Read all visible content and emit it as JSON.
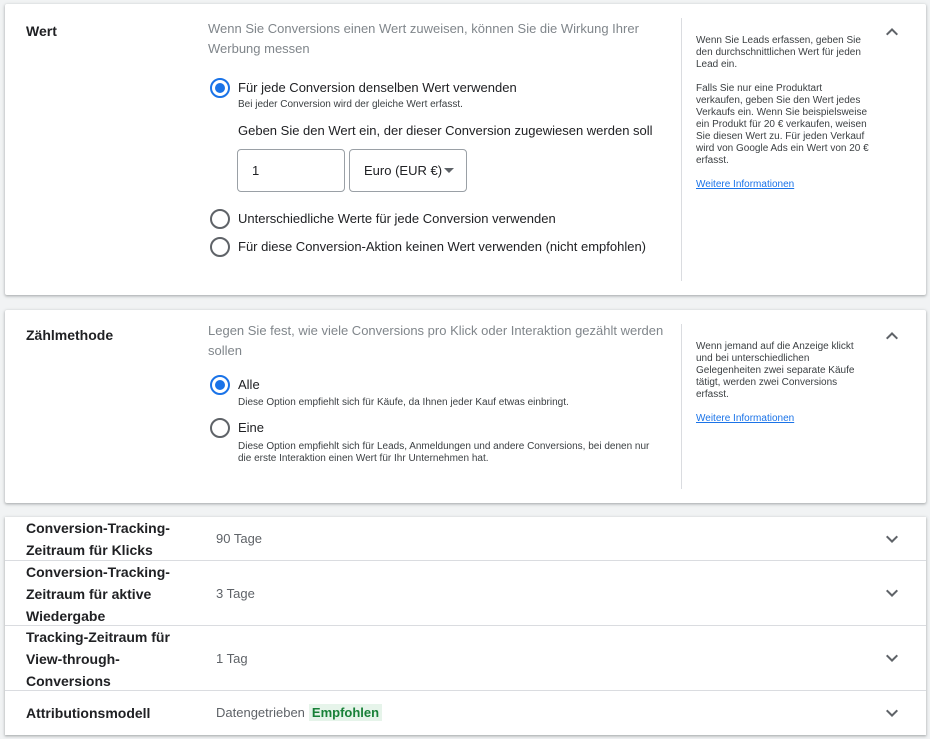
{
  "wert": {
    "title": "Wert",
    "description": "Wenn Sie Conversions einen Wert zuweisen, können Sie die Wirkung Ihrer Werbung messen",
    "option_same_label": "Für jede Conversion denselben Wert verwenden",
    "option_same_sub": "Bei jeder Conversion wird der gleiche Wert erfasst.",
    "value_prompt": "Geben Sie den Wert ein, der dieser Conversion zugewiesen werden soll",
    "value_input": "1",
    "currency": "Euro (EUR €)",
    "option_different_label": "Unterschiedliche Werte für jede Conversion verwenden",
    "option_none_label": "Für diese Conversion-Aktion keinen Wert verwenden (nicht empfohlen)",
    "help_p1": "Wenn Sie Leads erfassen, geben Sie den durchschnittlichen Wert für jeden Lead ein.",
    "help_p2": "Falls Sie nur eine Produktart verkaufen, geben Sie den Wert jedes Verkaufs ein. Wenn Sie beispielsweise ein Produkt für 20 € verkaufen, weisen Sie diesen Wert zu. Für jeden Verkauf wird von Google Ads ein Wert von 20 € erfasst.",
    "help_link": "Weitere Informationen"
  },
  "zaehlmethode": {
    "title": "Zählmethode",
    "description": "Legen Sie fest, wie viele Conversions pro Klick oder Interaktion gezählt werden sollen",
    "option_all_label": "Alle",
    "option_all_sub": "Diese Option empfiehlt sich für Käufe, da Ihnen jeder Kauf etwas einbringt.",
    "option_one_label": "Eine",
    "option_one_sub": "Diese Option empfiehlt sich für Leads, Anmeldungen und andere Conversions, bei denen nur die erste Interaktion einen Wert für Ihr Unternehmen hat.",
    "help_p1": "Wenn jemand auf die Anzeige klickt und bei unterschiedlichen Gelegenheiten zwei separate Käufe tätigt, werden zwei Conversions erfasst.",
    "help_link": "Weitere Informationen"
  },
  "rows": [
    {
      "label": "Conversion-Tracking-Zeitraum für Klicks",
      "value": "90 Tage"
    },
    {
      "label": "Conversion-Tracking-Zeitraum für aktive Wiedergabe",
      "value": "3 Tage"
    },
    {
      "label": "Tracking-Zeitraum für View-through-Conversions",
      "value": "1 Tag"
    },
    {
      "label": "Attributionsmodell",
      "value": "Datengetrieben",
      "badge": "Empfohlen"
    }
  ],
  "icons": {
    "collapse": "chevron-up-icon",
    "expand": "chevron-down-icon"
  },
  "colors": {
    "accent": "#1a73e8",
    "recommended_text": "#188038",
    "recommended_bg": "#e6f4ea"
  }
}
